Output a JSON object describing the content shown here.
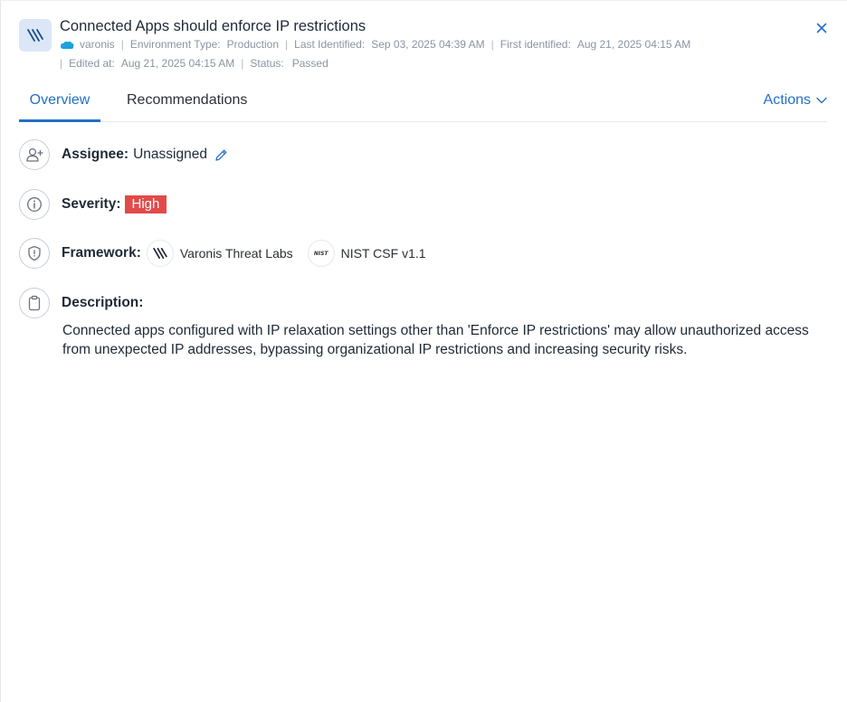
{
  "header": {
    "title": "Connected Apps should enforce IP restrictions",
    "meta_row1": {
      "account": "varonis",
      "environment_label": "Environment Type:",
      "environment_value": "Production",
      "last_identified_label": "Last Identified:",
      "last_identified_value": "Sep 03, 2025 04:39 AM",
      "first_identified_label": "First identified:",
      "first_identified_value": "Aug 21, 2025 04:15 AM"
    },
    "meta_row2": {
      "edited_label": "Edited at:",
      "edited_value": "Aug 21, 2025 04:15 AM",
      "status_label": "Status:",
      "status_value": "Passed"
    },
    "separator": "|",
    "icons": {
      "app": "varonis-logo-icon",
      "source": "salesforce-cloud-icon",
      "close": "close-icon"
    }
  },
  "tabs": [
    {
      "label": "Overview",
      "active": true
    },
    {
      "label": "Recommendations",
      "active": false
    }
  ],
  "actions": {
    "label": "Actions",
    "icon": "chevron-down-icon"
  },
  "fields": {
    "assignee": {
      "label": "Assignee:",
      "value": "Unassigned",
      "icon": "add-user-icon",
      "edit_icon": "pencil-icon"
    },
    "severity": {
      "label": "Severity:",
      "value": "High",
      "icon": "info-icon",
      "badge_color": "#e24a4a"
    },
    "framework": {
      "label": "Framework:",
      "icon": "shield-icon",
      "items": [
        {
          "name": "Varonis Threat Labs",
          "icon": "varonis-logo-icon"
        },
        {
          "name": "NIST CSF v1.1",
          "icon": "nist-logo-icon",
          "logo_text": "NIST"
        }
      ]
    },
    "description": {
      "label": "Description:",
      "icon": "clipboard-icon",
      "text": "Connected apps configured with IP relaxation settings other than 'Enforce IP restrictions' may allow unauthorized access from unexpected IP addresses, bypassing organizational IP restrictions and increasing security risks."
    }
  },
  "colors": {
    "accent": "#2370c6",
    "severity_high": "#e24a4a",
    "muted_text": "#8a94a3"
  }
}
